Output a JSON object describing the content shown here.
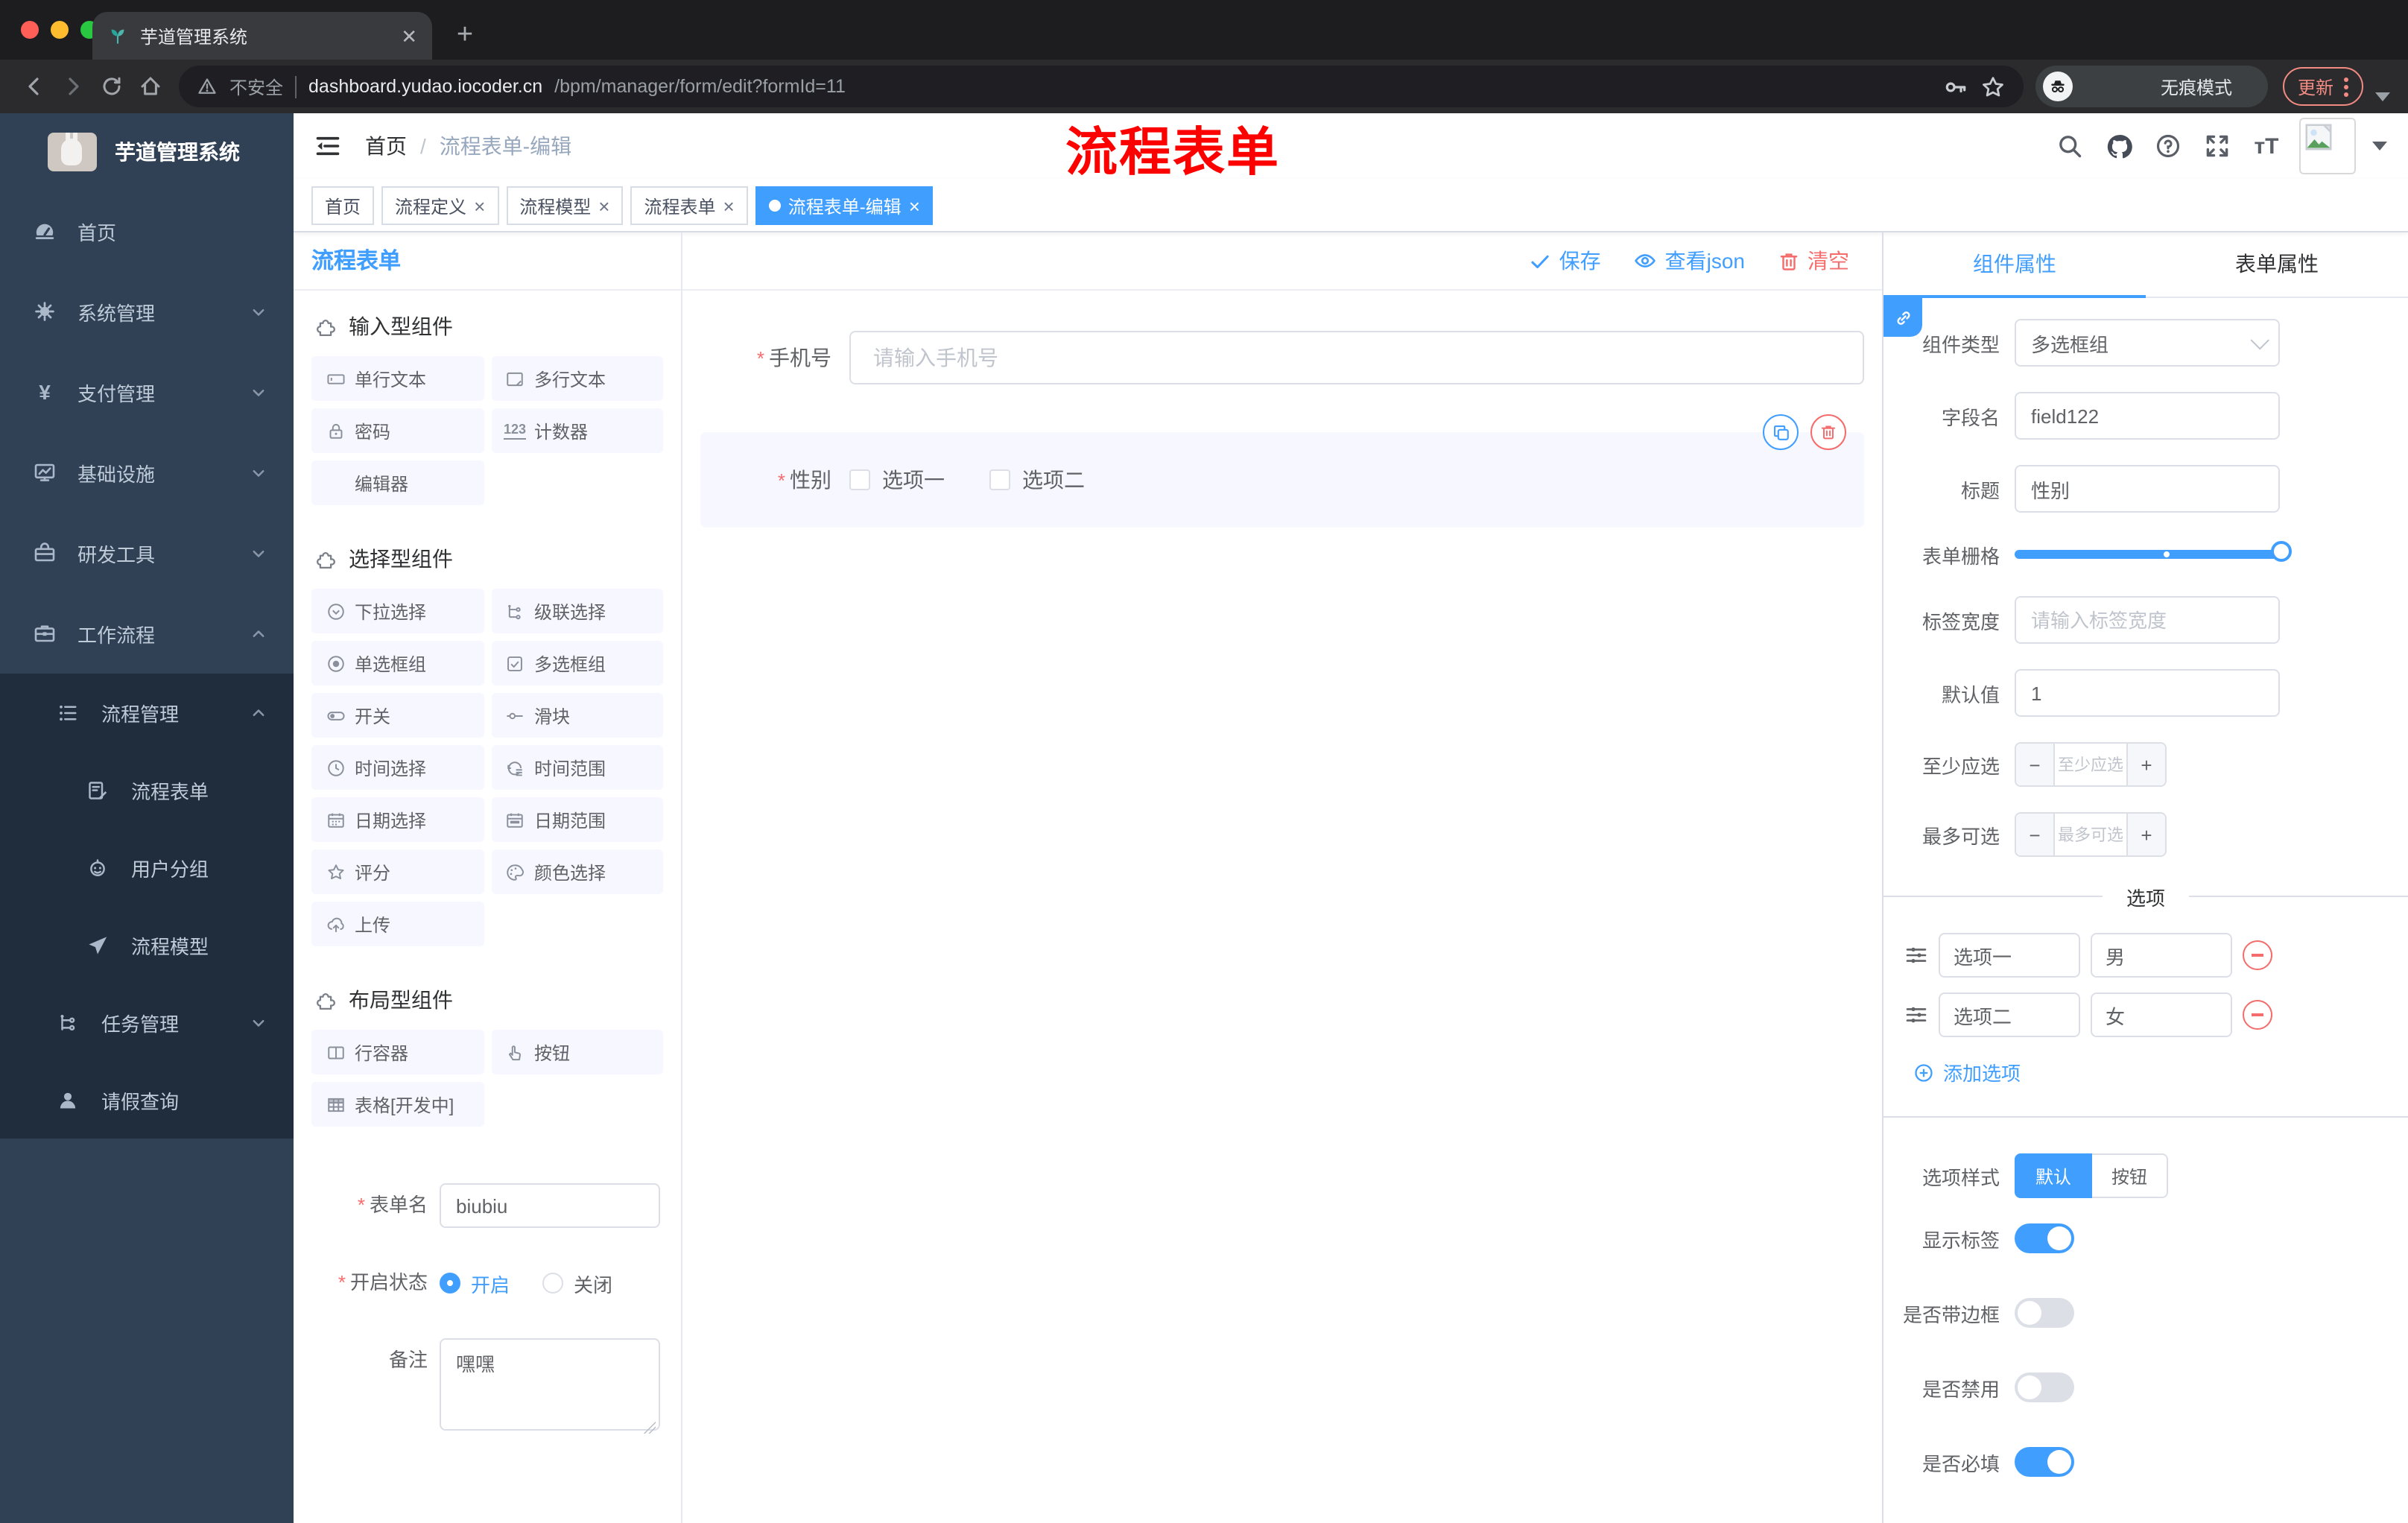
{
  "browser": {
    "tab": {
      "title": "芋道管理系统",
      "favicon": "sprout-icon"
    },
    "address": {
      "security": "不安全",
      "host": "dashboard.yudao.iocoder.cn",
      "path": "/bpm/manager/form/edit?formId=11"
    },
    "incognito_label": "无痕模式",
    "update_label": "更新",
    "traffic_lights": [
      "#ff5f57",
      "#febc2e",
      "#28c840"
    ]
  },
  "sidebar": {
    "title": "芋道管理系统",
    "items": [
      {
        "label": "首页",
        "icon": "dashboard-icon",
        "level": 1,
        "arrow": ""
      },
      {
        "label": "系统管理",
        "icon": "gear-icon",
        "level": 1,
        "arrow": "down"
      },
      {
        "label": "支付管理",
        "icon": "yen-icon",
        "level": 1,
        "arrow": "down"
      },
      {
        "label": "基础设施",
        "icon": "monitor-icon",
        "level": 1,
        "arrow": "down"
      },
      {
        "label": "研发工具",
        "icon": "toolbox-icon",
        "level": 1,
        "arrow": "down"
      },
      {
        "label": "工作流程",
        "icon": "briefcase-icon",
        "level": 1,
        "arrow": "up"
      },
      {
        "label": "流程管理",
        "icon": "list-icon",
        "level": 2,
        "arrow": "up"
      },
      {
        "label": "流程表单",
        "icon": "form-edit-icon",
        "level": 3,
        "arrow": ""
      },
      {
        "label": "用户分组",
        "icon": "robot-icon",
        "level": 3,
        "arrow": ""
      },
      {
        "label": "流程模型",
        "icon": "send-icon",
        "level": 3,
        "arrow": ""
      },
      {
        "label": "任务管理",
        "icon": "tree-icon",
        "level": 2,
        "arrow": "down"
      },
      {
        "label": "请假查询",
        "icon": "user-icon",
        "level": 2,
        "arrow": ""
      }
    ]
  },
  "header": {
    "breadcrumb": [
      "首页",
      "流程表单-编辑"
    ],
    "annotation": "流程表单"
  },
  "tags_view": [
    {
      "label": "首页",
      "closable": false,
      "active": false
    },
    {
      "label": "流程定义",
      "closable": true,
      "active": false
    },
    {
      "label": "流程模型",
      "closable": true,
      "active": false
    },
    {
      "label": "流程表单",
      "closable": true,
      "active": false
    },
    {
      "label": "流程表单-编辑",
      "closable": true,
      "active": true
    }
  ],
  "designer": {
    "title": "流程表单",
    "save": "保存",
    "view_json": "查看json",
    "clear": "清空"
  },
  "components": {
    "sections": [
      {
        "title": "输入型组件",
        "icon": "puzzle-icon",
        "items": [
          {
            "label": "单行文本",
            "icon": "input-icon"
          },
          {
            "label": "多行文本",
            "icon": "textarea-icon"
          },
          {
            "label": "密码",
            "icon": "lock-icon"
          },
          {
            "label": "计数器",
            "icon": "number-icon"
          },
          {
            "label": "编辑器",
            "icon": ""
          }
        ]
      },
      {
        "title": "选择型组件",
        "icon": "puzzle-icon",
        "items": [
          {
            "label": "下拉选择",
            "icon": "select-icon"
          },
          {
            "label": "级联选择",
            "icon": "cascader-icon"
          },
          {
            "label": "单选框组",
            "icon": "radio-icon"
          },
          {
            "label": "多选框组",
            "icon": "checkbox-icon"
          },
          {
            "label": "开关",
            "icon": "switch-icon"
          },
          {
            "label": "滑块",
            "icon": "slider-icon"
          },
          {
            "label": "时间选择",
            "icon": "time-icon"
          },
          {
            "label": "时间范围",
            "icon": "time-range-icon"
          },
          {
            "label": "日期选择",
            "icon": "date-icon"
          },
          {
            "label": "日期范围",
            "icon": "date-range-icon"
          },
          {
            "label": "评分",
            "icon": "star-icon"
          },
          {
            "label": "颜色选择",
            "icon": "palette-icon"
          },
          {
            "label": "上传",
            "icon": "upload-icon"
          }
        ]
      },
      {
        "title": "布局型组件",
        "icon": "puzzle-icon",
        "items": [
          {
            "label": "行容器",
            "icon": "row-icon"
          },
          {
            "label": "按钮",
            "icon": "pointer-icon"
          },
          {
            "label": "表格[开发中]",
            "icon": "table-icon"
          }
        ]
      }
    ],
    "form": {
      "name_label": "表单名",
      "name_value": "biubiu",
      "status_label": "开启状态",
      "status_options": [
        "开启",
        "关闭"
      ],
      "status_selected": "开启",
      "remark_label": "备注",
      "remark_value": "嘿嘿"
    }
  },
  "canvas": {
    "phone": {
      "label": "手机号",
      "required": true,
      "placeholder": "请输入手机号"
    },
    "gender": {
      "label": "性别",
      "required": true,
      "options": [
        "选项一",
        "选项二"
      ]
    }
  },
  "props": {
    "tabs": [
      "组件属性",
      "表单属性"
    ],
    "active_tab": "组件属性",
    "fields": {
      "type_label": "组件类型",
      "type_value": "多选框组",
      "field_label": "字段名",
      "field_value": "field122",
      "title_label": "标题",
      "title_value": "性别",
      "grid_label": "表单栅格",
      "width_label": "标签宽度",
      "width_placeholder": "请输入标签宽度",
      "default_label": "默认值",
      "default_value": "1",
      "min_label": "至少应选",
      "min_placeholder": "至少应选",
      "max_label": "最多可选",
      "max_placeholder": "最多可选"
    },
    "options_divider": "选项",
    "options": [
      {
        "label": "选项一",
        "value": "男"
      },
      {
        "label": "选项二",
        "value": "女"
      }
    ],
    "add_option": "添加选项",
    "style": {
      "label": "选项样式",
      "choices": [
        "默认",
        "按钮"
      ],
      "selected": "默认"
    },
    "switches": [
      {
        "label": "显示标签",
        "on": true
      },
      {
        "label": "是否带边框",
        "on": false
      },
      {
        "label": "是否禁用",
        "on": false
      },
      {
        "label": "是否必填",
        "on": true
      }
    ]
  },
  "colors": {
    "primary": "#409eff",
    "danger": "#f56c6c",
    "sidebar_bg": "#304156",
    "submenu_bg": "#1f2d3d",
    "annotation_red": "#fd0100",
    "selected_block_bg": "#f6f7ff"
  }
}
